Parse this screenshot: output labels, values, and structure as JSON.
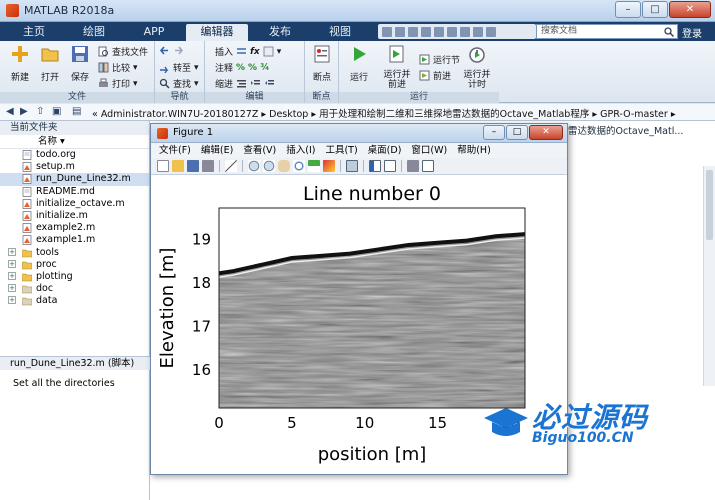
{
  "window": {
    "title": "MATLAB R2018a",
    "minimize": "–",
    "maximize": "□",
    "close": "✕"
  },
  "tabs": [
    {
      "label": "主页"
    },
    {
      "label": "绘图"
    },
    {
      "label": "APP"
    },
    {
      "label": "编辑器"
    },
    {
      "label": "发布"
    },
    {
      "label": "视图"
    }
  ],
  "search": {
    "placeholder": "搜索文档"
  },
  "login_label": "登录",
  "ribbon": {
    "file": {
      "group": "文件",
      "new": "新建",
      "open": "打开",
      "save": "保存",
      "find_files": "查找文件",
      "compare": "比较",
      "print": "打印"
    },
    "nav": {
      "group": "导航",
      "goto": "转至",
      "find": "查找"
    },
    "edit": {
      "group": "编辑",
      "insert": "插入",
      "comment": "注释",
      "indent": "缩进"
    },
    "breakpoints": {
      "group": "断点",
      "bp": "断点"
    },
    "run": {
      "group": "运行",
      "run": "运行",
      "run_advance": "运行并\n前进",
      "run_section": "运行节",
      "advance": "前进",
      "run_time": "运行并\n计时"
    }
  },
  "address": {
    "path": "« Administrator.WIN7U-20180127Z  ▸  Desktop  ▸  用于处理和绘制二维和三维探地雷达数据的Octave_Matlab程序  ▸  GPR-O-master  ▸"
  },
  "left_panel": {
    "title": "当前文件夹",
    "col_name": "名称 ▾",
    "files": [
      {
        "name": "todo.org",
        "type": "file"
      },
      {
        "name": "setup.m",
        "type": "mfile"
      },
      {
        "name": "run_Dune_Line32.m",
        "type": "mfile",
        "selected": true
      },
      {
        "name": "README.md",
        "type": "file"
      },
      {
        "name": "initialize_octave.m",
        "type": "mfile"
      },
      {
        "name": "initialize.m",
        "type": "mfile"
      },
      {
        "name": "example2.m",
        "type": "mfile"
      },
      {
        "name": "example1.m",
        "type": "mfile"
      },
      {
        "name": "tools",
        "type": "folder"
      },
      {
        "name": "proc",
        "type": "folder"
      },
      {
        "name": "plotting",
        "type": "folder"
      },
      {
        "name": "doc",
        "type": "folder-gray"
      },
      {
        "name": "data",
        "type": "folder-gray"
      }
    ],
    "detail_header": "run_Dune_Line32.m  (脚本)",
    "detail_text": "Set all the directories"
  },
  "workspace": {
    "header_fragment": "雷达数据的Octave_Matl..."
  },
  "figure": {
    "title": "Figure 1",
    "menu": [
      "文件(F)",
      "编辑(E)",
      "查看(V)",
      "插入(I)",
      "工具(T)",
      "桌面(D)",
      "窗口(W)",
      "帮助(H)"
    ]
  },
  "chart_data": {
    "type": "heatmap",
    "title": "Line number 0",
    "xlabel": "position [m]",
    "ylabel": "Elevation [m]",
    "xlim": [
      0,
      21
    ],
    "ylim": [
      15.1,
      19.7
    ],
    "xticks": [
      "0",
      "5",
      "10",
      "15",
      "20"
    ],
    "yticks": [
      "16",
      "17",
      "18",
      "19"
    ],
    "surface_line": {
      "x": [
        0,
        1,
        3,
        5,
        7,
        9,
        11,
        13,
        15,
        17,
        19,
        21
      ],
      "y": [
        18.2,
        18.25,
        18.4,
        18.55,
        18.6,
        18.65,
        18.75,
        18.85,
        18.9,
        18.95,
        19.05,
        19.1
      ]
    },
    "colormap": "gray"
  },
  "watermark": {
    "title": "必过源码",
    "sub": "Biguo100.CN",
    "brand_color": "#1b74d1"
  }
}
